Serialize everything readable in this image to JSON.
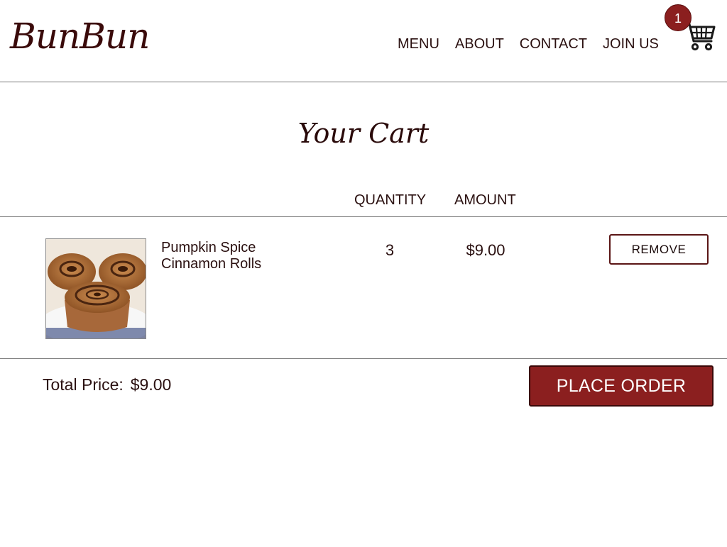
{
  "brand": {
    "logo_text": "BunBun",
    "accent_color": "#8b1f1f"
  },
  "nav": {
    "items": [
      {
        "label": "MENU"
      },
      {
        "label": "ABOUT"
      },
      {
        "label": "CONTACT"
      },
      {
        "label": "JOIN US"
      }
    ],
    "cart_icon": "cart-icon",
    "cart_count": "1"
  },
  "cart": {
    "title": "Your Cart",
    "columns": {
      "quantity": "QUANTITY",
      "amount": "AMOUNT"
    },
    "items": [
      {
        "image_icon": "cinnamon-rolls-photo",
        "name": "Pumpkin Spice Cinnamon Rolls",
        "quantity": "3",
        "amount": "$9.00",
        "remove_label": "REMOVE"
      }
    ],
    "total_label": "Total Price:",
    "total_value": "$9.00",
    "place_order_label": "PLACE ORDER"
  }
}
